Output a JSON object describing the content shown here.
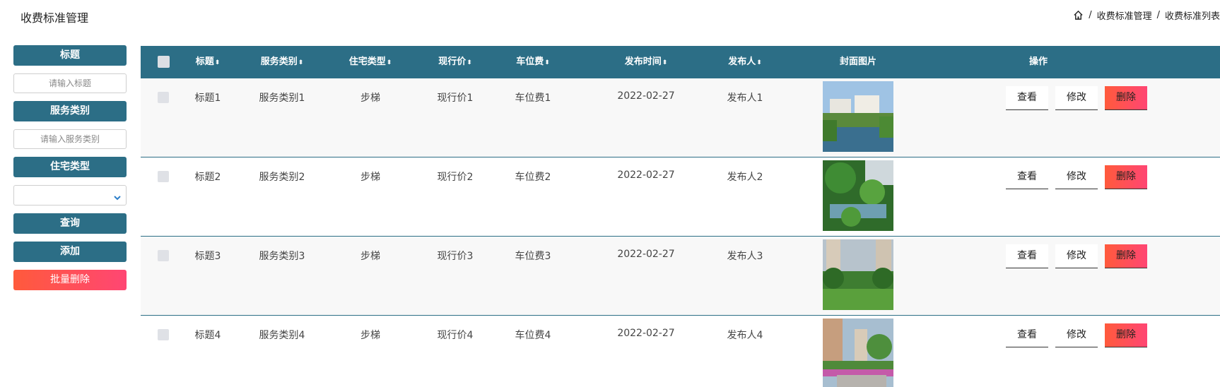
{
  "header": {
    "title": "收费标准管理",
    "breadcrumb": [
      "收费标准管理",
      "收费标准列表"
    ],
    "separator": "/"
  },
  "search": {
    "title_label": "标题",
    "title_placeholder": "请输入标题",
    "category_label": "服务类别",
    "category_placeholder": "请输入服务类别",
    "housing_label": "住宅类型",
    "housing_value": "",
    "query_button": "查询",
    "add_button": "添加",
    "batch_delete_button": "批量删除"
  },
  "table": {
    "columns": [
      "标题",
      "服务类别",
      "住宅类型",
      "现行价",
      "车位费",
      "发布时间",
      "发布人",
      "封面图片",
      "操作"
    ],
    "sort_glyph": "⬍",
    "rows": [
      {
        "title": "标题1",
        "category": "服务类别1",
        "housing": "步梯",
        "price": "现行价1",
        "parking": "车位费1",
        "date": "2022-02-27",
        "publisher": "发布人1",
        "cover": "cover-image-residential-lake"
      },
      {
        "title": "标题2",
        "category": "服务类别2",
        "housing": "步梯",
        "price": "现行价2",
        "parking": "车位费2",
        "date": "2022-02-27",
        "publisher": "发布人2",
        "cover": "cover-image-garden-pond"
      },
      {
        "title": "标题3",
        "category": "服务类别3",
        "housing": "步梯",
        "price": "现行价3",
        "parking": "车位费3",
        "date": "2022-02-27",
        "publisher": "发布人3",
        "cover": "cover-image-lawn-towers"
      },
      {
        "title": "标题4",
        "category": "服务类别4",
        "housing": "步梯",
        "price": "现行价4",
        "parking": "车位费4",
        "date": "2022-02-27",
        "publisher": "发布人4",
        "cover": "cover-image-walkway-flowers"
      }
    ],
    "actions": {
      "view": "查看",
      "edit": "修改",
      "delete": "删除"
    }
  },
  "colors": {
    "primary": "#2c6e86",
    "danger_start": "#ff5a3c",
    "danger_end": "#ff4673"
  }
}
